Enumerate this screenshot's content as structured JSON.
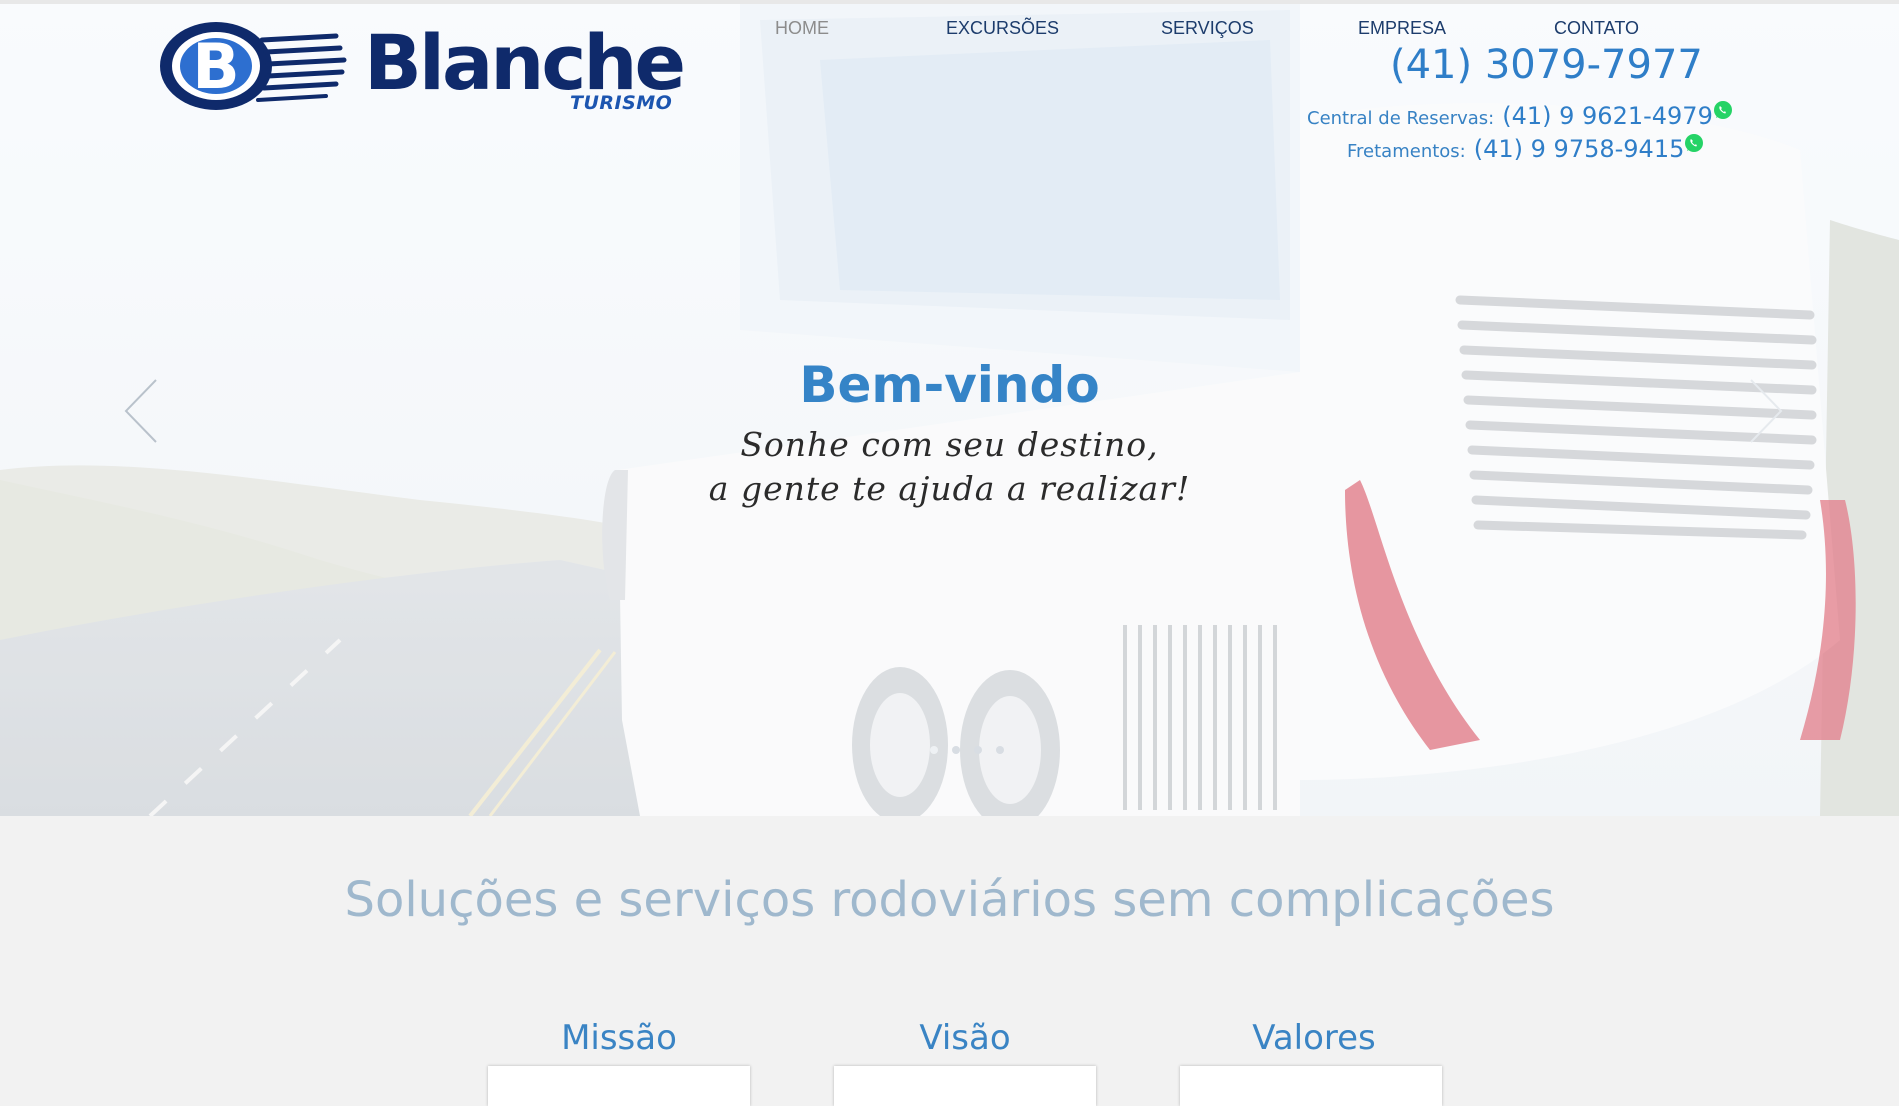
{
  "brand": {
    "name": "Blanche",
    "sub": "TURISMO",
    "colors": {
      "navy": "#0f2a6b",
      "blue": "#2f7ec8",
      "whatsapp": "#25d366"
    }
  },
  "nav": {
    "items": [
      {
        "label": "HOME",
        "active": true
      },
      {
        "label": "EXCURSÕES",
        "active": false
      },
      {
        "label": "SERVIÇOS",
        "active": false
      },
      {
        "label": "EMPRESA",
        "active": false
      },
      {
        "label": "CONTATO",
        "active": false
      }
    ]
  },
  "contact": {
    "main_phone": "(41) 3079-7977",
    "reservas_label": "Central de Reservas:",
    "reservas_phone": "(41) 9 9621-4979",
    "fretamentos_label": "Fretamentos:",
    "fretamentos_phone": "(41) 9 9758-9415",
    "icon": "whatsapp-icon"
  },
  "hero": {
    "title": "Bem-vindo",
    "line1": "Sonhe com seu destino,",
    "line2": "a gente te ajuda a realizar!",
    "prev_icon": "chevron-left-icon",
    "next_icon": "chevron-right-icon",
    "slide_count": 4,
    "active_slide": 1
  },
  "tagline": "Soluções e serviços rodoviários sem complicações",
  "columns": [
    {
      "title": "Missão"
    },
    {
      "title": "Visão"
    },
    {
      "title": "Valores"
    }
  ]
}
